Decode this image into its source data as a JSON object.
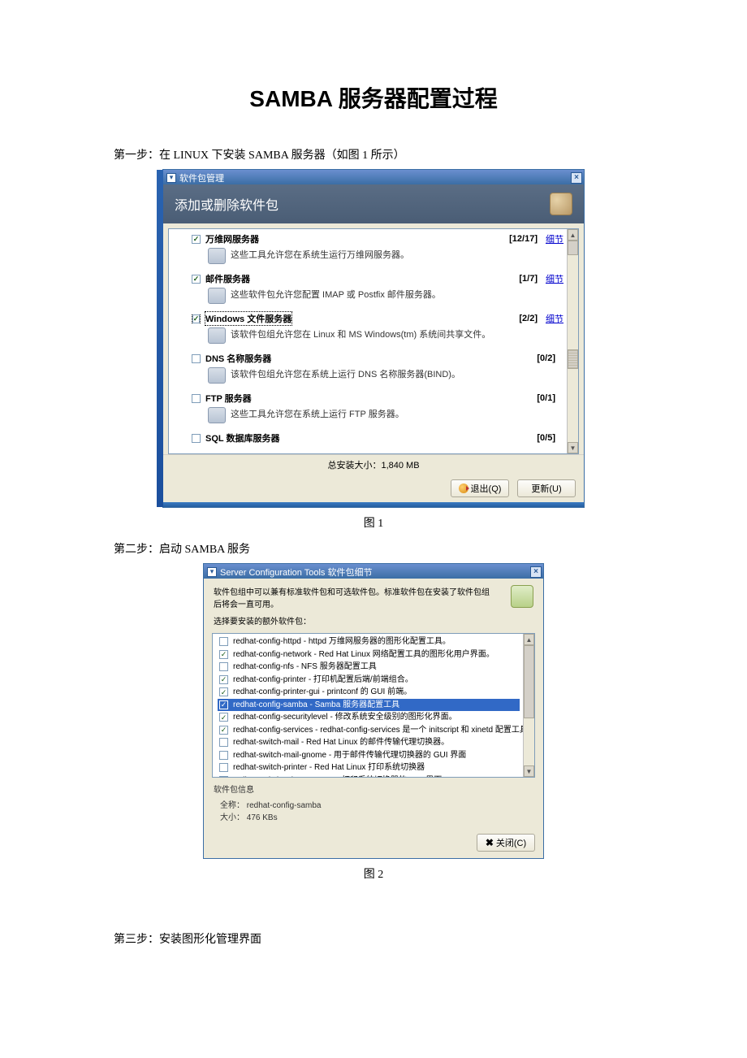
{
  "doc": {
    "title": "SAMBA 服务器配置过程",
    "step1": "第一步：在 LINUX 下安装 SAMBA 服务器（如图 1 所示）",
    "step2": "第二步：启动 SAMBA 服务",
    "step3": "第三步：安装图形化管理界面",
    "fig1": "图 1",
    "fig2": "图 2"
  },
  "win1": {
    "title": "软件包管理",
    "banner": "添加或删除软件包",
    "items": [
      {
        "checked": true,
        "name": "万维网服务器",
        "count": "[12/17]",
        "desc": "这些工具允许您在系统生运行万维网服务器。",
        "detail": true
      },
      {
        "checked": true,
        "name": "邮件服务器",
        "count": "[1/7]",
        "desc": "这些软件包允许您配置 IMAP 或 Postfix 邮件服务器。",
        "detail": true
      },
      {
        "checked": true,
        "name": "Windows 文件服务器",
        "count": "[2/2]",
        "desc": "该软件包组允许您在 Linux 和 MS Windows(tm) 系统间共享文件。",
        "detail": true,
        "selected": true
      },
      {
        "checked": false,
        "name": "DNS 名称服务器",
        "count": "[0/2]",
        "desc": "该软件包组允许您在系统上运行 DNS 名称服务器(BIND)。",
        "detail": false
      },
      {
        "checked": false,
        "name": "FTP 服务器",
        "count": "[0/1]",
        "desc": "这些工具允许您在系统上运行 FTP 服务器。",
        "detail": false
      },
      {
        "checked": false,
        "name": "SQL 数据库服务器",
        "count": "[0/5]",
        "desc": "",
        "detail": false
      }
    ],
    "detail_label": "细节",
    "size_label": "总安装大小：1,840 MB",
    "quit": "退出(Q)",
    "update": "更新(U)"
  },
  "win2": {
    "title": "Server Configuration Tools 软件包细节",
    "desc1": "软件包组中可以兼有标准软件包和可选软件包。标准软件包在安装了软件包组后将会一直可用。",
    "desc2": "选择要安装的额外软件包：",
    "items": [
      {
        "checked": false,
        "text": "redhat-config-httpd - httpd 万维网服务器的图形化配置工具。"
      },
      {
        "checked": true,
        "text": "redhat-config-network - Red Hat Linux 网络配置工具的图形化用户界面。"
      },
      {
        "checked": false,
        "text": "redhat-config-nfs - NFS 服务器配置工具"
      },
      {
        "checked": true,
        "text": "redhat-config-printer - 打印机配置后端/前端组合。"
      },
      {
        "checked": true,
        "text": "redhat-config-printer-gui - printconf 的 GUI 前端。"
      },
      {
        "checked": true,
        "text": "redhat-config-samba - Samba 服务器配置工具",
        "selected": true
      },
      {
        "checked": true,
        "text": "redhat-config-securitylevel - 修改系统安全级别的图形化界面。"
      },
      {
        "checked": true,
        "text": "redhat-config-services - redhat-config-services 是一个 initscript 和 xinetd 配置工具。"
      },
      {
        "checked": false,
        "text": "redhat-switch-mail - Red Hat Linux 的邮件传输代理切换器。"
      },
      {
        "checked": false,
        "text": "redhat-switch-mail-gnome - 用于邮件传输代理切换器的 GUI 界面"
      },
      {
        "checked": false,
        "text": "redhat-switch-printer - Red Hat Linux 打印系统切换器"
      },
      {
        "checked": false,
        "text": "redhat-switch-printer-gnome - 打印系统切换器的 GUI 界面。"
      }
    ],
    "info_section": "软件包信息",
    "info_name_label": "全称：",
    "info_name": "redhat-config-samba",
    "info_size_label": "大小：",
    "info_size": "476 KBs",
    "close": "关闭(C)"
  }
}
